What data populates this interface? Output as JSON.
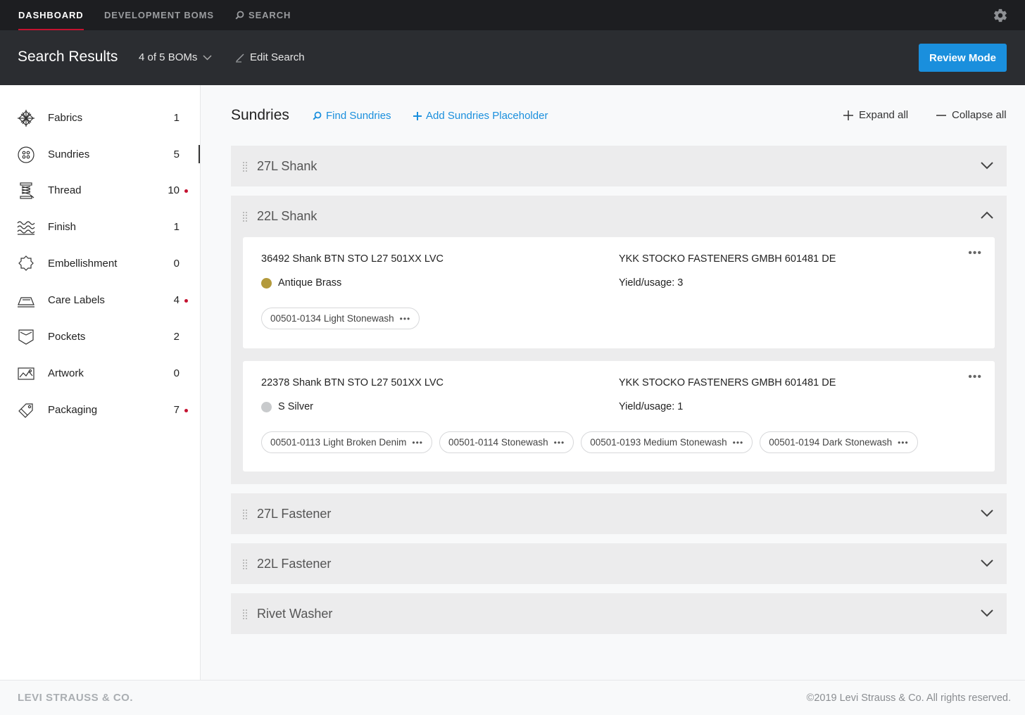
{
  "topnav": {
    "items": [
      {
        "label": "DASHBOARD",
        "active": true
      },
      {
        "label": "DEVELOPMENT BOMs",
        "active": false
      },
      {
        "label": "SEARCH",
        "active": false,
        "icon": "search-icon"
      }
    ],
    "settings_icon": "gear-icon"
  },
  "header": {
    "title": "Search Results",
    "bom_selector": "4 of 5 BOMs",
    "edit_search": "Edit Search",
    "review_button": "Review Mode"
  },
  "sidebar": {
    "items": [
      {
        "label": "Fabrics",
        "count": "1",
        "icon": "fabric-icon",
        "alert": false
      },
      {
        "label": "Sundries",
        "count": "5",
        "icon": "button-icon",
        "alert": false,
        "active": true
      },
      {
        "label": "Thread",
        "count": "10",
        "icon": "spool-icon",
        "alert": true
      },
      {
        "label": "Finish",
        "count": "1",
        "icon": "waves-icon",
        "alert": false
      },
      {
        "label": "Embellishment",
        "count": "0",
        "icon": "badge-icon",
        "alert": false
      },
      {
        "label": "Care Labels",
        "count": "4",
        "icon": "iron-icon",
        "alert": true
      },
      {
        "label": "Pockets",
        "count": "2",
        "icon": "pocket-icon",
        "alert": false
      },
      {
        "label": "Artwork",
        "count": "0",
        "icon": "image-icon",
        "alert": false
      },
      {
        "label": "Packaging",
        "count": "7",
        "icon": "tag-icon",
        "alert": true
      }
    ]
  },
  "main": {
    "title": "Sundries",
    "find_link": "Find Sundries",
    "add_link": "Add Sundries Placeholder",
    "expand_all": "Expand all",
    "collapse_all": "Collapse all",
    "groups": [
      {
        "title": "27L Shank",
        "expanded": false
      },
      {
        "title": "22L Shank",
        "expanded": true
      },
      {
        "title": "27L Fastener",
        "expanded": false
      },
      {
        "title": "22L Fastener",
        "expanded": false
      },
      {
        "title": "Rivet Washer",
        "expanded": false
      }
    ],
    "cards": [
      {
        "name": "36492 Shank BTN STO L27 501XX LVC",
        "vendor": "YKK STOCKO FASTENERS GMBH 601481 DE",
        "color": "Antique Brass",
        "swatch": "#b39a3c",
        "yield": "Yield/usage: 3",
        "chips": [
          "00501-0134 Light Stonewash"
        ]
      },
      {
        "name": "22378 Shank BTN STO L27 501XX LVC",
        "vendor": "YKK STOCKO FASTENERS GMBH 601481 DE",
        "color": "S Silver",
        "swatch": "#c8cacc",
        "yield": "Yield/usage: 1",
        "chips": [
          "00501-0113 Light Broken Denim",
          "00501-0114 Stonewash",
          "00501-0193 Medium Stonewash",
          "00501-0194 Dark Stonewash"
        ]
      }
    ]
  },
  "footer": {
    "logo": "LEVI STRAUSS & CO.",
    "copyright": "©2019 Levi Strauss & Co. All rights reserved."
  },
  "colors": {
    "accent": "#1a8fdd",
    "alert": "#c41230",
    "nav_bg": "#1d1e21",
    "header_bg": "#2b2d31"
  }
}
